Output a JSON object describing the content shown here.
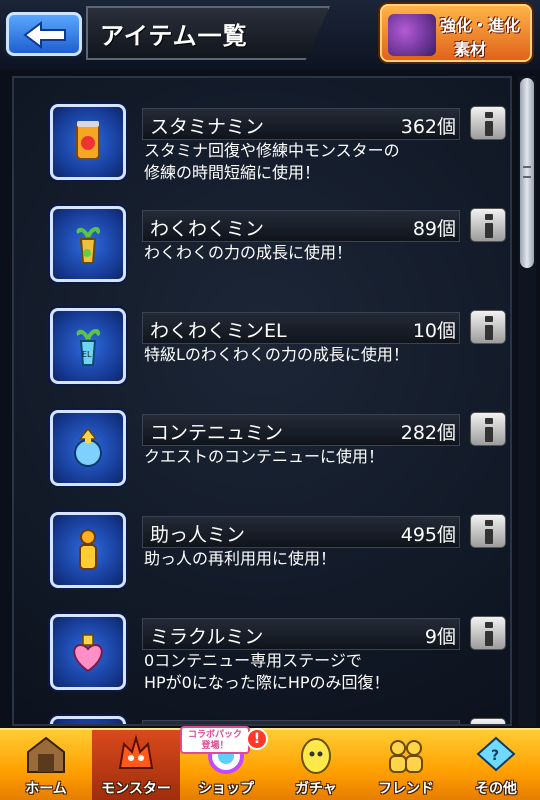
{
  "header": {
    "title": "アイテム一覧",
    "badge": {
      "line1": "強化・進化",
      "line2": "素材"
    }
  },
  "items": [
    {
      "name": "スタミナミン",
      "count": "362個",
      "desc": "スタミナ回復や修練中モンスターの\n修練の時間短縮に使用！",
      "icon": "stamina-can-icon"
    },
    {
      "name": "わくわくミン",
      "count": "89個",
      "desc": "わくわくの力の成長に使用！",
      "icon": "sprout-bottle-icon"
    },
    {
      "name": "わくわくミンEL",
      "count": "10個",
      "desc": "特級Lのわくわくの力の成長に使用！",
      "icon": "sprout-bottle-el-icon"
    },
    {
      "name": "コンテニュミン",
      "count": "282個",
      "desc": "クエストのコンテニューに使用！",
      "icon": "continue-potion-icon"
    },
    {
      "name": "助っ人ミン",
      "count": "495個",
      "desc": "助っ人の再利用用に使用！",
      "icon": "helper-bottle-icon"
    },
    {
      "name": "ミラクルミン",
      "count": "9個",
      "desc": "0コンテニュー専用ステージで\nHPが0になった際にHPのみ回復！",
      "icon": "heart-potion-icon"
    }
  ],
  "nav": {
    "tabs": [
      {
        "label": "ホーム"
      },
      {
        "label": "モンスター"
      },
      {
        "label": "ショップ"
      },
      {
        "label": "ガチャ"
      },
      {
        "label": "フレンド"
      },
      {
        "label": "その他"
      }
    ],
    "collab_tag": "コラボパック\n登場！",
    "alert": "!"
  }
}
